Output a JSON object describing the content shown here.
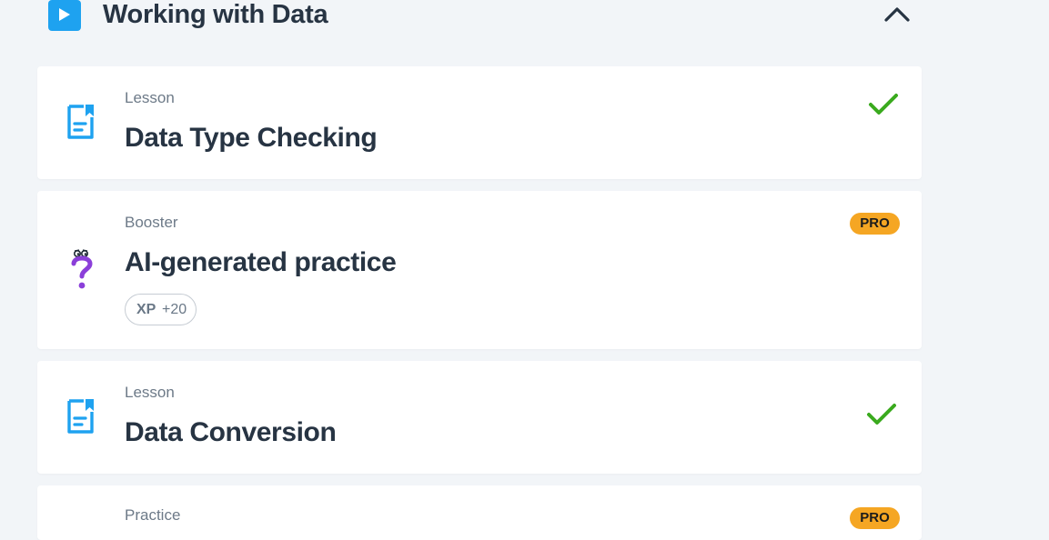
{
  "module": {
    "title": "Working with Data",
    "icon": "play-icon",
    "collapse_icon": "chevron-up-icon"
  },
  "colors": {
    "accent": "#1ea2f0",
    "check": "#3aaa1e",
    "pro": "#f5a623",
    "booster_icon": "#8b3fd9"
  },
  "items": [
    {
      "type": "Lesson",
      "title": "Data Type Checking",
      "icon": "lesson-document-icon",
      "status": "completed"
    },
    {
      "type": "Booster",
      "title": "AI-generated practice",
      "icon": "question-mark-icon",
      "badge": "PRO",
      "xp_label": "XP",
      "xp_value": "+20"
    },
    {
      "type": "Lesson",
      "title": "Data Conversion",
      "icon": "lesson-document-icon",
      "status": "completed"
    },
    {
      "type": "Practice",
      "badge": "PRO"
    }
  ]
}
